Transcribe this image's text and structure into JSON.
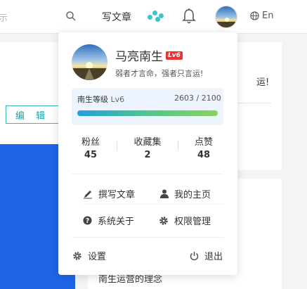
{
  "topbar": {
    "left_fragment": "示",
    "write_label": "写文章",
    "lang_label": "En",
    "icons": [
      "search-icon",
      "dots-icon",
      "bell-icon",
      "globe-icon"
    ]
  },
  "page": {
    "edit_label": "编 辑",
    "right_text": "运!",
    "bottom_text": "南生运营的理念"
  },
  "dropdown": {
    "name": "马亮南生",
    "badge": "Lv6",
    "motto": "弱者才言命，强者只言运!",
    "level_label": "南生等级",
    "level_value": "Lv6",
    "level_progress": "2603 / 2100",
    "stats": [
      {
        "label": "粉丝",
        "value": "45"
      },
      {
        "label": "收藏集",
        "value": "2"
      },
      {
        "label": "点赞",
        "value": "48"
      }
    ],
    "menu": {
      "write": "撰写文章",
      "home": "我的主页",
      "about": "系统关于",
      "perm": "权限管理",
      "settings": "设置",
      "logout": "退出"
    }
  },
  "colors": {
    "accent": "#39c5c9",
    "badge": "#e33333",
    "blue_block": "#1e64e6",
    "level_bg": "#eef4fe"
  }
}
